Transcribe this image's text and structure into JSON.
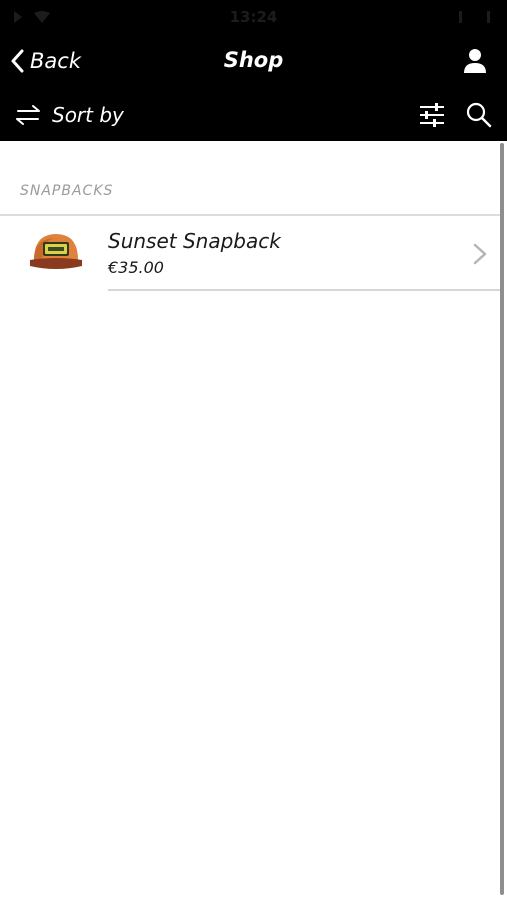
{
  "status_bar": {
    "time": "13:24"
  },
  "nav": {
    "back_label": "Back",
    "title": "Shop",
    "account_icon": "user-icon"
  },
  "toolbar": {
    "sort_label": "Sort by",
    "sort_icon": "swap-arrows-icon",
    "filter_icon": "sliders-icon",
    "search_icon": "search-icon"
  },
  "section": {
    "title": "SNAPBACKS"
  },
  "products": [
    {
      "name": "Sunset Snapback",
      "price": "€35.00",
      "thumb_icon": "snapback-cap-image"
    }
  ],
  "colors": {
    "header_bg": "#000000",
    "header_text": "#ffffff",
    "section_title": "#9b9b9b",
    "divider": "#dcdcdc"
  }
}
